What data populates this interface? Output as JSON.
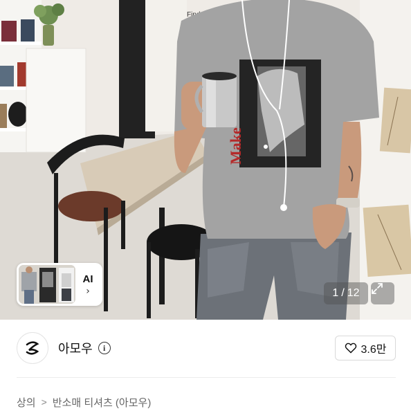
{
  "gallery": {
    "current_index": "1",
    "total": "12",
    "counter_sep": "/",
    "ai_button_label": "AI",
    "ai_button_icon": "chevron-right-icon",
    "expand_icon": "expand-icon",
    "shirt_print_text": "Make"
  },
  "shop": {
    "name": "아모우",
    "info_icon": "info-icon",
    "like_count": "3.6만",
    "like_icon": "heart-icon"
  },
  "breadcrumb": {
    "items": [
      "상의",
      "반소매 티셔츠 (아모우)"
    ],
    "separator_icon": "chevron-right-icon"
  },
  "colors": {
    "accent_print_red": "#b42a2a",
    "shirt_gray": "#9c9c9c",
    "counter_bg": "rgba(80,80,80,0.45)"
  }
}
